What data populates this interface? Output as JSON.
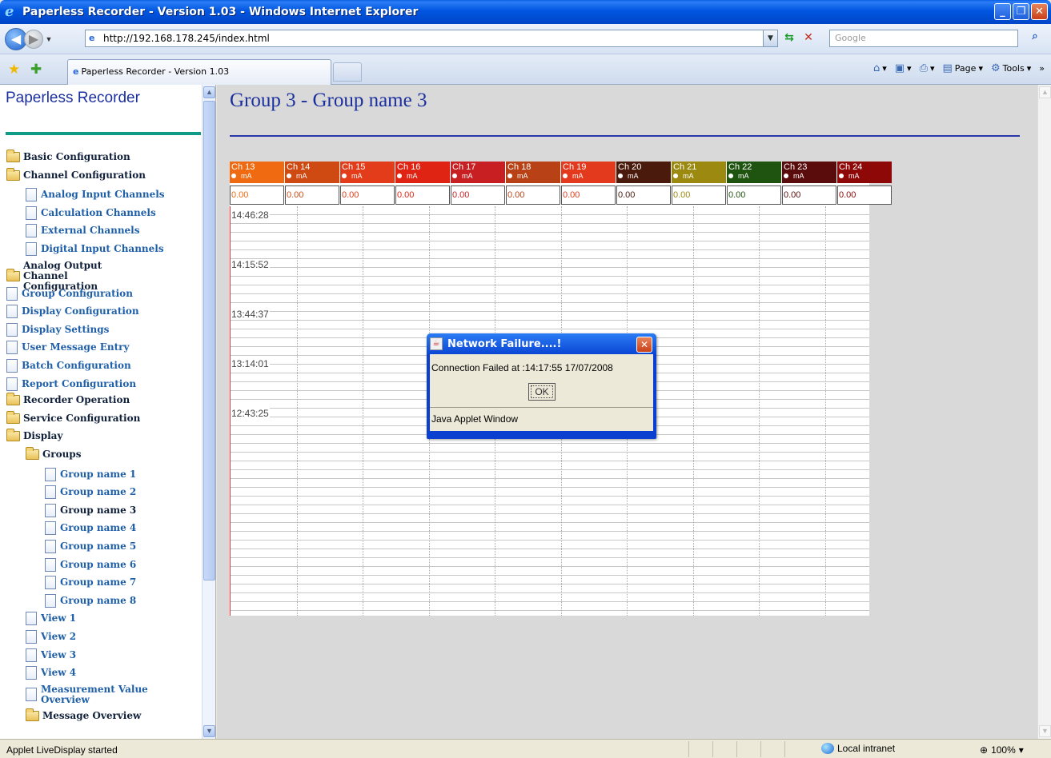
{
  "window": {
    "title": "Paperless Recorder - Version 1.03 - Windows Internet Explorer",
    "minimize": "_",
    "maximize": "❐",
    "close": "✕"
  },
  "address": {
    "url": "http://192.168.178.245/index.html",
    "search_placeholder": "Google"
  },
  "tabbar": {
    "tab_title": "Paperless Recorder - Version 1.03",
    "commands": [
      "Page",
      "Tools"
    ]
  },
  "sidebar": {
    "title": "Paperless Recorder",
    "items": [
      {
        "label": "Basic Configuration",
        "icon": "folder-icon",
        "level": 0,
        "color": "dark"
      },
      {
        "label": "Channel Configuration",
        "icon": "folder-open-icon",
        "level": 0,
        "color": "dark"
      },
      {
        "label": "Analog Input Channels",
        "icon": "document-icon",
        "level": 1,
        "color": "link"
      },
      {
        "label": "Calculation Channels",
        "icon": "document-icon",
        "level": 1,
        "color": "link"
      },
      {
        "label": "External Channels",
        "icon": "document-icon",
        "level": 1,
        "color": "link"
      },
      {
        "label": "Digital Input Channels",
        "icon": "document-icon",
        "level": 1,
        "color": "link"
      },
      {
        "label": "Analog Output Channel Configuration",
        "icon": "folder-icon",
        "level": 0,
        "color": "dark"
      },
      {
        "label": "Group Configuration",
        "icon": "document-icon",
        "level": 0,
        "color": "link"
      },
      {
        "label": "Display Configuration",
        "icon": "document-icon",
        "level": 0,
        "color": "link"
      },
      {
        "label": "Display Settings",
        "icon": "document-icon",
        "level": 0,
        "color": "link"
      },
      {
        "label": "User Message Entry",
        "icon": "document-icon",
        "level": 0,
        "color": "link"
      },
      {
        "label": "Batch Configuration",
        "icon": "document-icon",
        "level": 0,
        "color": "link"
      },
      {
        "label": "Report Configuration",
        "icon": "document-icon",
        "level": 0,
        "color": "link"
      },
      {
        "label": "Recorder Operation",
        "icon": "folder-icon",
        "level": 0,
        "color": "dark"
      },
      {
        "label": "Service Configuration",
        "icon": "folder-icon",
        "level": 0,
        "color": "dark"
      },
      {
        "label": "Display",
        "icon": "folder-open-icon",
        "level": 0,
        "color": "dark"
      },
      {
        "label": "Groups",
        "icon": "folder-open-icon",
        "level": 1,
        "color": "dark"
      },
      {
        "label": "Group name 1",
        "icon": "document-icon",
        "level": 2,
        "color": "link"
      },
      {
        "label": "Group name 2",
        "icon": "document-icon",
        "level": 2,
        "color": "link"
      },
      {
        "label": "Group name 3",
        "icon": "document-icon",
        "level": 2,
        "color": "dark"
      },
      {
        "label": "Group name 4",
        "icon": "document-icon",
        "level": 2,
        "color": "link"
      },
      {
        "label": "Group name 5",
        "icon": "document-icon",
        "level": 2,
        "color": "link"
      },
      {
        "label": "Group name 6",
        "icon": "document-icon",
        "level": 2,
        "color": "link"
      },
      {
        "label": "Group name 7",
        "icon": "document-icon",
        "level": 2,
        "color": "link"
      },
      {
        "label": "Group name 8",
        "icon": "document-icon",
        "level": 2,
        "color": "link"
      },
      {
        "label": "View 1",
        "icon": "document-icon",
        "level": 1,
        "color": "link"
      },
      {
        "label": "View 2",
        "icon": "document-icon",
        "level": 1,
        "color": "link"
      },
      {
        "label": "View 3",
        "icon": "document-icon",
        "level": 1,
        "color": "link"
      },
      {
        "label": "View 4",
        "icon": "document-icon",
        "level": 1,
        "color": "link"
      },
      {
        "label": "Measurement Value Overview",
        "icon": "document-icon",
        "level": 1,
        "color": "link"
      },
      {
        "label": "Message Overview",
        "icon": "folder-icon",
        "level": 1,
        "color": "dark"
      }
    ]
  },
  "main": {
    "group_title": "Group 3 - Group name 3",
    "channels": [
      {
        "name": "Ch 13",
        "unit": "mA",
        "value": "0.00",
        "color": "#ef6a10"
      },
      {
        "name": "Ch 14",
        "unit": "mA",
        "value": "0.00",
        "color": "#cf4a12"
      },
      {
        "name": "Ch 15",
        "unit": "mA",
        "value": "0.00",
        "color": "#e23c1a"
      },
      {
        "name": "Ch 16",
        "unit": "mA",
        "value": "0.00",
        "color": "#df2414"
      },
      {
        "name": "Ch 17",
        "unit": "mA",
        "value": "0.00",
        "color": "#c71f22"
      },
      {
        "name": "Ch 18",
        "unit": "mA",
        "value": "0.00",
        "color": "#b84216"
      },
      {
        "name": "Ch 19",
        "unit": "mA",
        "value": "0.00",
        "color": "#e3391c"
      },
      {
        "name": "Ch 20",
        "unit": "mA",
        "value": "0.00",
        "color": "#4a1a0c"
      },
      {
        "name": "Ch 21",
        "unit": "mA",
        "value": "0.00",
        "color": "#9c8a10"
      },
      {
        "name": "Ch 22",
        "unit": "mA",
        "value": "0.00",
        "color": "#1f5410"
      },
      {
        "name": "Ch 23",
        "unit": "mA",
        "value": "0.00",
        "color": "#5a0c0c"
      },
      {
        "name": "Ch 24",
        "unit": "mA",
        "value": "0.00",
        "color": "#8f0808"
      }
    ],
    "time_labels": [
      "14:46:28",
      "14:15:52",
      "13:44:37",
      "13:14:01",
      "12:43:25"
    ]
  },
  "dialog": {
    "title": "Network Failure....!",
    "message": "Connection Failed at :14:17:55 17/07/2008",
    "ok_label": "OK",
    "footer": "Java Applet Window"
  },
  "status": {
    "text": "Applet LiveDisplay started",
    "zone": "Local intranet",
    "zoom": "100%"
  }
}
